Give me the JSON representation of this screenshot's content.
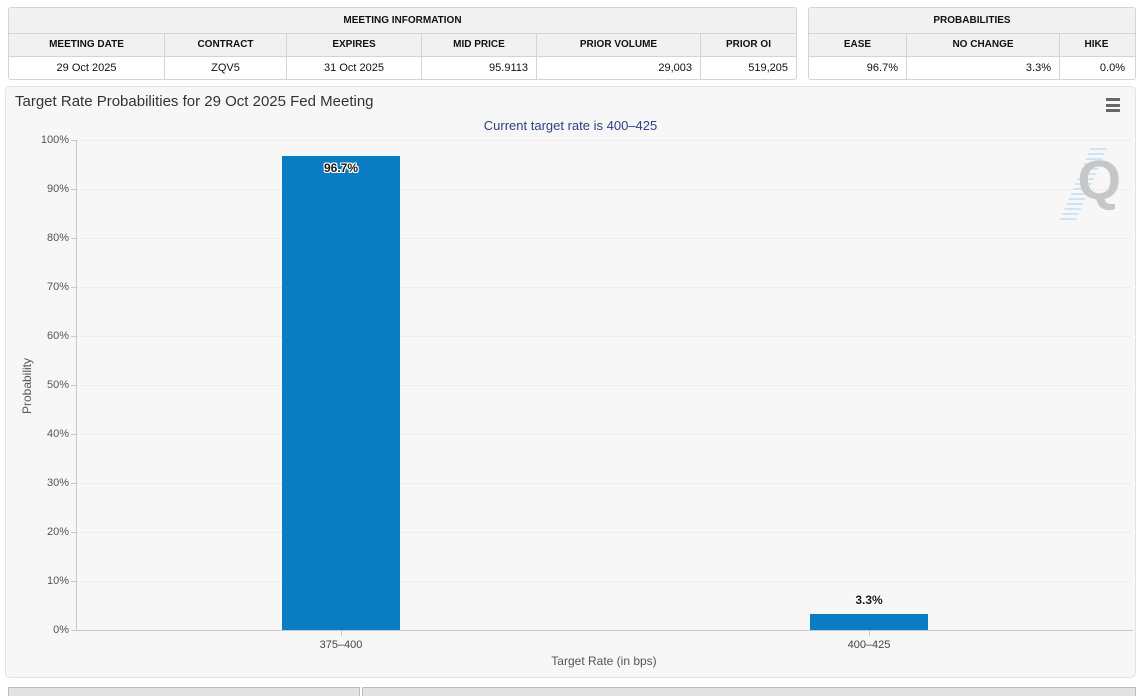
{
  "meeting_info_table": {
    "title": "MEETING INFORMATION",
    "columns": [
      "MEETING DATE",
      "CONTRACT",
      "EXPIRES",
      "MID PRICE",
      "PRIOR VOLUME",
      "PRIOR OI"
    ],
    "row": [
      "29 Oct 2025",
      "ZQV5",
      "31 Oct 2025",
      "95.9113",
      "29,003",
      "519,205"
    ]
  },
  "probabilities_table": {
    "title": "PROBABILITIES",
    "columns": [
      "EASE",
      "NO CHANGE",
      "HIKE"
    ],
    "row": [
      "96.7%",
      "3.3%",
      "0.0%"
    ]
  },
  "chart_data": {
    "type": "bar",
    "title": "Target Rate Probabilities for 29 Oct 2025 Fed Meeting",
    "subtitle": "Current target rate is 400–425",
    "categories": [
      "375–400",
      "400–425"
    ],
    "values": [
      96.7,
      3.3
    ],
    "value_labels": [
      "96.7%",
      "3.3%"
    ],
    "xlabel": "Target Rate (in bps)",
    "ylabel": "Probability",
    "ylim": [
      0,
      100
    ],
    "ytick_step": 10,
    "ytick_suffix": "%",
    "grid": "dotted horizontal",
    "legend_position": "none",
    "bar_color": "#0a7cc1",
    "subtitle_color": "#2f3f85",
    "watermark_letter": "Q"
  },
  "icons": {
    "chart_menu": "hamburger-menu-icon",
    "watermark": "quikstrike-q-watermark"
  }
}
